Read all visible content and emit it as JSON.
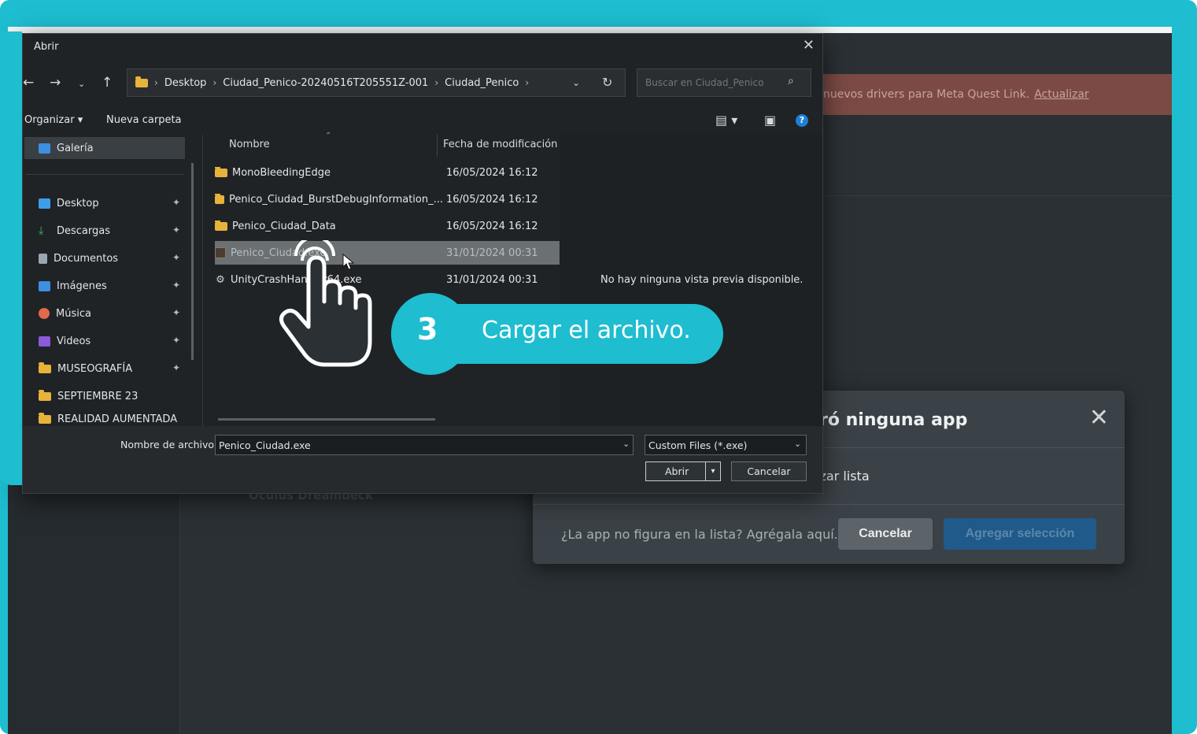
{
  "background_app": {
    "banner_text": "nuevos drivers para Meta Quest Link.",
    "banner_link": "Actualizar",
    "faded_item": "Oculus Dreamdeck",
    "modal": {
      "title": "ró ninguna app",
      "subtitle": "izar lista",
      "question": "¿La app no figura en la lista? Agrégala aquí.",
      "cancel_label": "Cancelar",
      "add_label": "Agregar selección"
    }
  },
  "dialog": {
    "title": "Abrir",
    "breadcrumbs": [
      "Desktop",
      "Ciudad_Penico-20240516T205551Z-001",
      "Ciudad_Penico"
    ],
    "search_placeholder": "Buscar en Ciudad_Penico",
    "toolbar": {
      "organize": "Organizar",
      "new_folder": "Nueva carpeta"
    },
    "sidebar": [
      {
        "label": "Galería",
        "icon": "gallery-icon",
        "color": "#3d8fe0"
      },
      {
        "label": "Desktop",
        "icon": "desktop-icon",
        "color": "#3d9fe8"
      },
      {
        "label": "Descargas",
        "icon": "download-icon",
        "color": "#3dba6a"
      },
      {
        "label": "Documentos",
        "icon": "document-icon",
        "color": "#9aa6b2"
      },
      {
        "label": "Imágenes",
        "icon": "image-icon",
        "color": "#3d8fe0"
      },
      {
        "label": "Música",
        "icon": "music-icon",
        "color": "#e06a4a"
      },
      {
        "label": "Videos",
        "icon": "video-icon",
        "color": "#8a5ad8"
      },
      {
        "label": "MUSEOGRAFÍA",
        "icon": "folder-icon",
        "color": "#e8b33a"
      },
      {
        "label": "SEPTIEMBRE 23",
        "icon": "folder-icon",
        "color": "#e8b33a"
      },
      {
        "label": "REALIDAD AUMENTADA",
        "icon": "folder-icon",
        "color": "#e8b33a"
      }
    ],
    "columns": {
      "name": "Nombre",
      "date": "Fecha de modificación"
    },
    "files": [
      {
        "name": "MonoBleedingEdge",
        "date": "16/05/2024 16:12",
        "type": "folder"
      },
      {
        "name": "Penico_Ciudad_BurstDebugInformation_...",
        "date": "16/05/2024 16:12",
        "type": "folder"
      },
      {
        "name": "Penico_Ciudad_Data",
        "date": "16/05/2024 16:12",
        "type": "folder"
      },
      {
        "name": "Penico_Ciudad.exe",
        "date": "31/01/2024 00:31",
        "type": "exe"
      },
      {
        "name": "UnityCrashHandler64.exe",
        "date": "31/01/2024 00:31",
        "type": "exe2"
      }
    ],
    "preview_text": "No hay ninguna vista previa disponible.",
    "filename_label": "Nombre de archivo:",
    "filename_value": "Penico_Ciudad.exe",
    "filter_value": "Custom Files (*.exe)",
    "open_label": "Abrir",
    "cancel_label": "Cancelar"
  },
  "callout": {
    "step": "3",
    "text": "Cargar el archivo."
  }
}
